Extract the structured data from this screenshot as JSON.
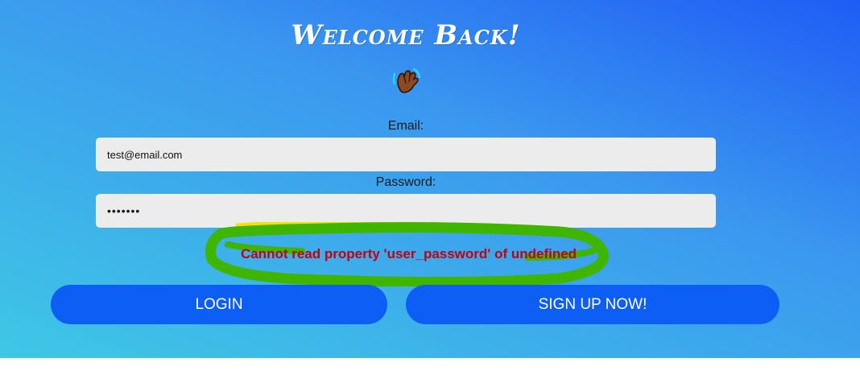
{
  "header": {
    "title": "Welcome Back!",
    "emoji": "👋🏾"
  },
  "form": {
    "email_label": "Email:",
    "email_value": "test@email.com",
    "password_label": "Password:",
    "password_value": "•••••••",
    "error_message": "Cannot read property 'user_password' of undefined",
    "error_color": "#c00010",
    "highlight_color": "#3fb500"
  },
  "buttons": {
    "login_label": "LOGIN",
    "signup_label": "SIGN UP NOW!",
    "button_color": "#0d5ef4"
  },
  "icons": {
    "wave": "waving-hand-icon"
  }
}
